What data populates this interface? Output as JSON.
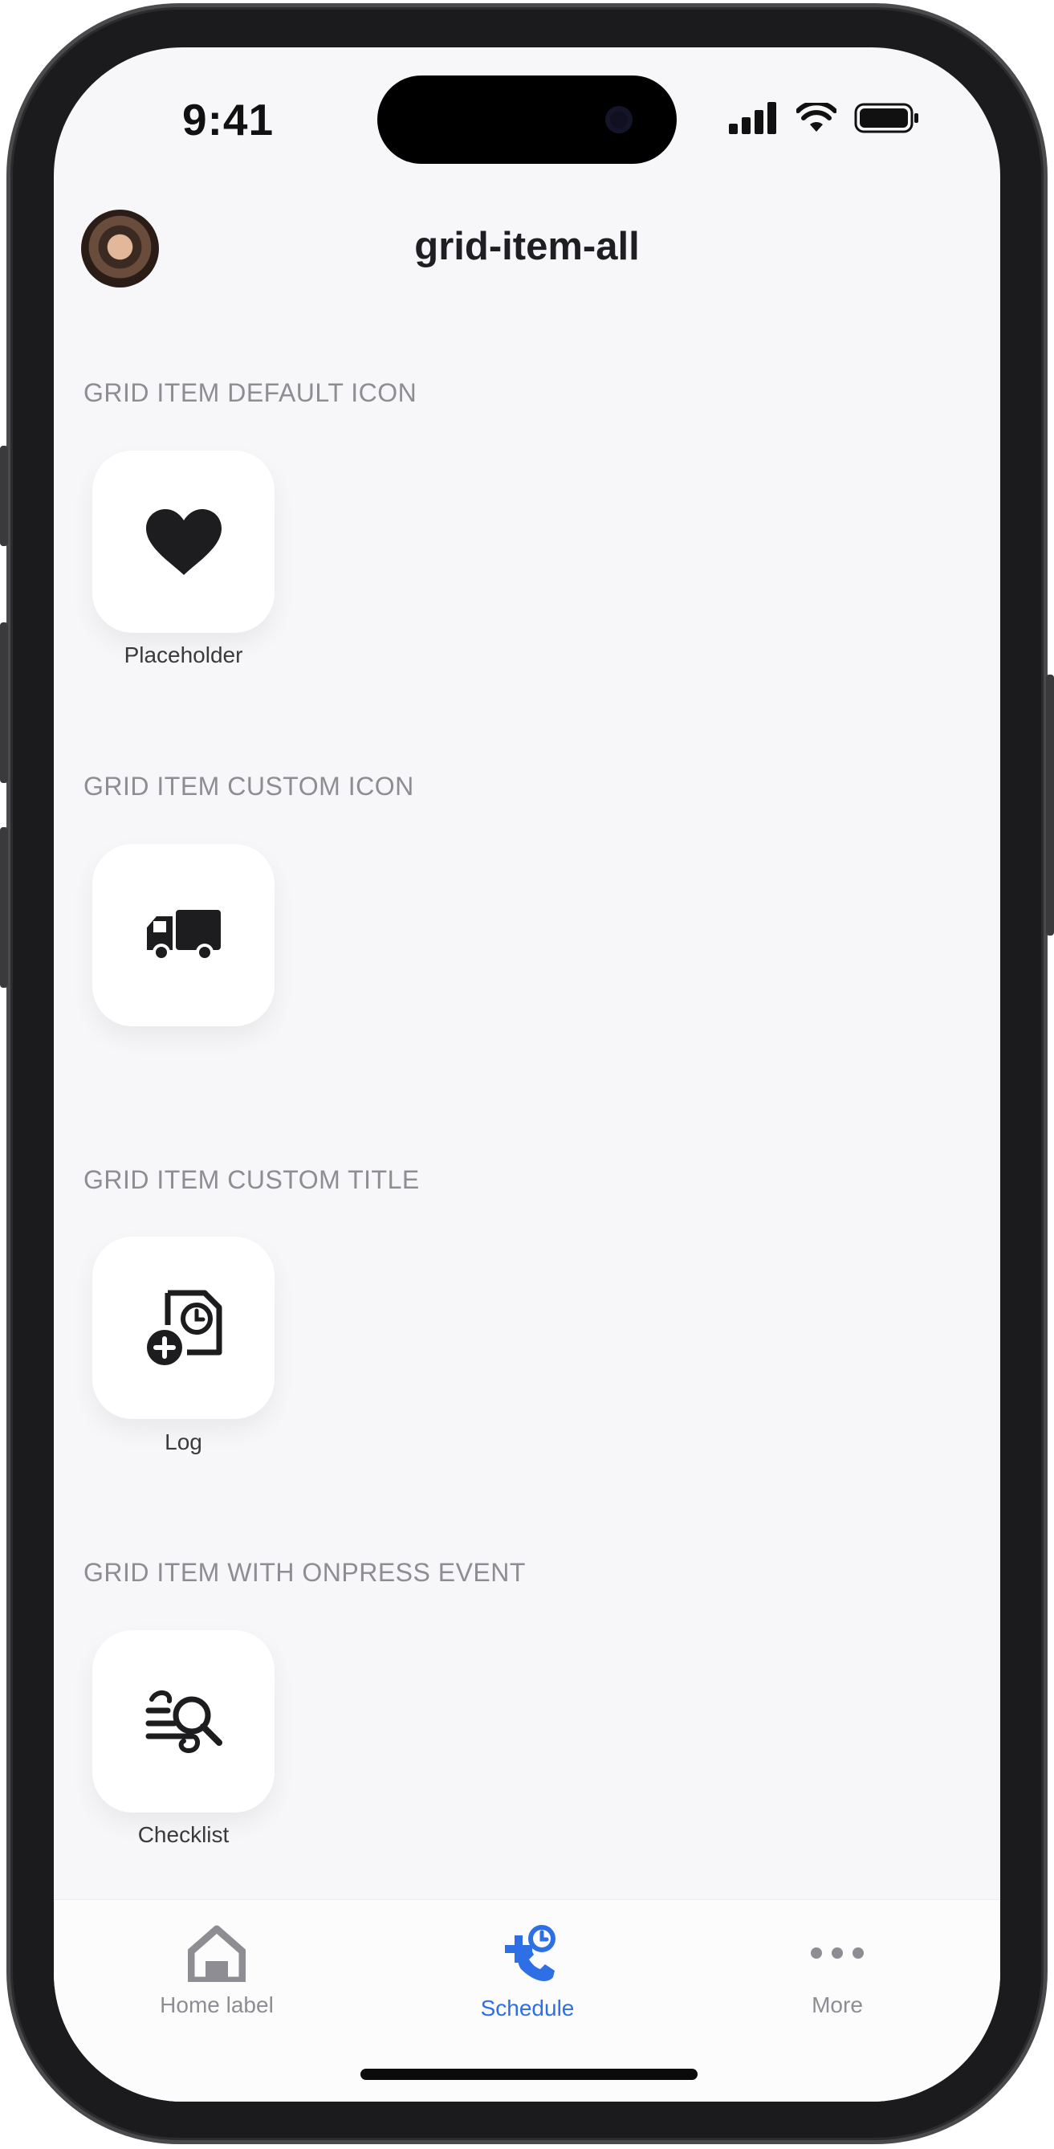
{
  "status_bar": {
    "time": "9:41"
  },
  "header": {
    "title": "grid-item-all"
  },
  "sections": [
    {
      "label": "GRID ITEM DEFAULT ICON",
      "item": {
        "icon": "heart-icon",
        "title": "Placeholder"
      }
    },
    {
      "label": "GRID ITEM CUSTOM ICON",
      "item": {
        "icon": "truck-icon",
        "title": ""
      }
    },
    {
      "label": "GRID ITEM CUSTOM TITLE",
      "item": {
        "icon": "document-clock-add-icon",
        "title": "Log"
      }
    },
    {
      "label": "GRID ITEM WITH ONPRESS EVENT",
      "item": {
        "icon": "search-list-icon",
        "title": "Checklist"
      }
    }
  ],
  "tabbar": {
    "tabs": [
      {
        "label": "Home label",
        "icon": "home-icon",
        "active": false
      },
      {
        "label": "Schedule",
        "icon": "medical-phone-icon",
        "active": true
      },
      {
        "label": "More",
        "icon": "more-dots-icon",
        "active": false
      }
    ],
    "active_color": "#2f6fe6",
    "inactive_color": "#8e8d93"
  }
}
